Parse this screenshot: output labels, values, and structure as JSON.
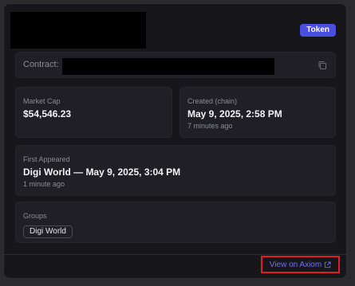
{
  "header": {
    "badge_label": "Token"
  },
  "contract": {
    "label": "Contract:"
  },
  "market_cap": {
    "label": "Market Cap",
    "value": "$54,546.23"
  },
  "created": {
    "label": "Created (chain)",
    "value": "May 9, 2025, 2:58 PM",
    "relative": "7 minutes ago"
  },
  "first_appeared": {
    "label": "First Appeared",
    "value": "Digi World — May 9, 2025, 3:04 PM",
    "relative": "1 minute ago"
  },
  "groups": {
    "label": "Groups",
    "items": [
      "Digi World"
    ]
  },
  "footer": {
    "link_label": "View on Axiom"
  },
  "colors": {
    "badge_bg": "#4a4fe0",
    "link": "#6a6ff2",
    "highlight_border": "#e01e1e"
  }
}
